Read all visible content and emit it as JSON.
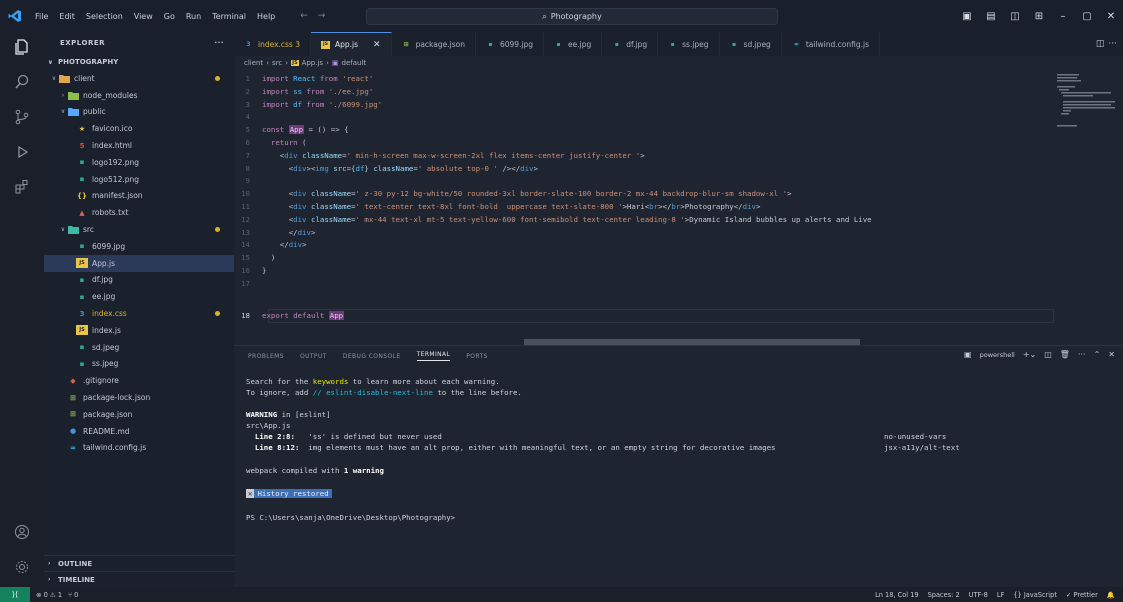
{
  "titlebar": {
    "menu": [
      "File",
      "Edit",
      "Selection",
      "View",
      "Go",
      "Run",
      "Terminal",
      "Help"
    ],
    "search": "Photography"
  },
  "sidebar": {
    "header": "EXPLORER",
    "root": "PHOTOGRAPHY",
    "tree": [
      {
        "label": "client",
        "depth": 0,
        "kind": "folder",
        "open": true,
        "dot": "#d7b32b",
        "color": "#e0a84a"
      },
      {
        "label": "node_modules",
        "depth": 1,
        "kind": "folder",
        "open": false,
        "color": "#8fbf4a"
      },
      {
        "label": "public",
        "depth": 1,
        "kind": "folder",
        "open": true,
        "color": "#58a6ff"
      },
      {
        "label": "favicon.ico",
        "depth": 2,
        "kind": "file",
        "glyph": "★",
        "color": "#e8c547"
      },
      {
        "label": "index.html",
        "depth": 2,
        "kind": "file",
        "glyph": "5",
        "color": "#e44d26"
      },
      {
        "label": "logo192.png",
        "depth": 2,
        "kind": "file",
        "glyph": "▪",
        "color": "#2bb08d"
      },
      {
        "label": "logo512.png",
        "depth": 2,
        "kind": "file",
        "glyph": "▪",
        "color": "#2bb08d"
      },
      {
        "label": "manifest.json",
        "depth": 2,
        "kind": "file",
        "glyph": "{}",
        "color": "#e8c547"
      },
      {
        "label": "robots.txt",
        "depth": 2,
        "kind": "file",
        "glyph": "▲",
        "color": "#e05d5d"
      },
      {
        "label": "src",
        "depth": 1,
        "kind": "folder",
        "open": true,
        "dot": "#d7b32b",
        "color": "#3fb8a5"
      },
      {
        "label": "6099.jpg",
        "depth": 2,
        "kind": "file",
        "glyph": "▪",
        "color": "#2bb08d"
      },
      {
        "label": "App.js",
        "depth": 2,
        "kind": "file",
        "glyph": "JS",
        "color": "#e8c547",
        "selected": true
      },
      {
        "label": "df.jpg",
        "depth": 2,
        "kind": "file",
        "glyph": "▪",
        "color": "#2bb08d"
      },
      {
        "label": "ee.jpg",
        "depth": 2,
        "kind": "file",
        "glyph": "▪",
        "color": "#2bb08d"
      },
      {
        "label": "index.css",
        "depth": 2,
        "kind": "file",
        "glyph": "3",
        "color": "#3c8ed8",
        "dot": "#d7b32b",
        "warn": true
      },
      {
        "label": "index.js",
        "depth": 2,
        "kind": "file",
        "glyph": "JS",
        "color": "#e8c547"
      },
      {
        "label": "sd.jpeg",
        "depth": 2,
        "kind": "file",
        "glyph": "▪",
        "color": "#2bb08d"
      },
      {
        "label": "ss.jpeg",
        "depth": 2,
        "kind": "file",
        "glyph": "▪",
        "color": "#2bb08d"
      },
      {
        "label": ".gitignore",
        "depth": 1,
        "kind": "file",
        "glyph": "◆",
        "color": "#e05d44"
      },
      {
        "label": "package-lock.json",
        "depth": 1,
        "kind": "file",
        "glyph": "⊞",
        "color": "#8cc152"
      },
      {
        "label": "package.json",
        "depth": 1,
        "kind": "file",
        "glyph": "⊞",
        "color": "#8cc152"
      },
      {
        "label": "README.md",
        "depth": 1,
        "kind": "file",
        "glyph": "●",
        "color": "#4a90e2"
      },
      {
        "label": "tailwind.config.js",
        "depth": 1,
        "kind": "file",
        "glyph": "≈",
        "color": "#38bdf8"
      }
    ],
    "outline": "OUTLINE",
    "timeline": "TIMELINE"
  },
  "tabs": [
    {
      "label": "index.css 3",
      "glyph": "3",
      "color": "#3c8ed8",
      "warn": true
    },
    {
      "label": "App.js",
      "glyph": "JS",
      "color": "#e8c547",
      "active": true
    },
    {
      "label": "package.json",
      "glyph": "⊞",
      "color": "#8cc152"
    },
    {
      "label": "6099.jpg",
      "glyph": "▪",
      "color": "#2bb08d"
    },
    {
      "label": "ee.jpg",
      "glyph": "▪",
      "color": "#2bb08d"
    },
    {
      "label": "df.jpg",
      "glyph": "▪",
      "color": "#2bb08d"
    },
    {
      "label": "ss.jpeg",
      "glyph": "▪",
      "color": "#2bb08d"
    },
    {
      "label": "sd.jpeg",
      "glyph": "▪",
      "color": "#2bb08d"
    },
    {
      "label": "tailwind.config.js",
      "glyph": "≈",
      "color": "#38bdf8"
    }
  ],
  "breadcrumb": [
    "client",
    "src",
    "App.js",
    "default"
  ],
  "editor": {
    "current_line": "18",
    "lines": [
      {
        "n": "1",
        "code": "import React from 'react'"
      },
      {
        "n": "2",
        "code": "import ss from './ee.jpg'"
      },
      {
        "n": "3",
        "code": "import df from './6099.jpg'"
      },
      {
        "n": "4",
        "code": ""
      },
      {
        "n": "5",
        "code": "const App = () => {"
      },
      {
        "n": "6",
        "code": "  return ("
      },
      {
        "n": "7",
        "code": "    <div className=' min-h-screen max-w-screen-2xl flex items-center justify-center '>"
      },
      {
        "n": "8",
        "code": "      <div><img src={df} className=' absolute top-0 ' /></div>"
      },
      {
        "n": "9",
        "code": ""
      },
      {
        "n": "10",
        "code": "      <div className=' z-30 py-12 bg-white/50 rounded-3xl border-slate-100 border-2 mx-44 backdrop-blur-sm shadow-xl '>"
      },
      {
        "n": "11",
        "code": "      <div className=' text-center text-8xl font-bold  uppercase text-slate-800 '>Hari<br></br>Photography</div>"
      },
      {
        "n": "12",
        "code": "      <div className=' mx-44 text-xl mt-5 text-yellow-600 font-semibold text-center leading-8 '>Dynamic Island bubbles up alerts and Live"
      },
      {
        "n": "13",
        "code": "      </div>"
      },
      {
        "n": "14",
        "code": "    </div>"
      },
      {
        "n": "15",
        "code": "  )"
      },
      {
        "n": "16",
        "code": "}"
      },
      {
        "n": "17",
        "code": ""
      },
      {
        "n": "18",
        "code": "export default App"
      }
    ]
  },
  "panel": {
    "tabs": [
      "PROBLEMS",
      "OUTPUT",
      "DEBUG CONSOLE",
      "TERMINAL",
      "PORTS"
    ],
    "active_tab": "TERMINAL",
    "shell": "powershell",
    "terminal": {
      "l1_pre": "Search for the ",
      "l1_kw": "keywords",
      "l1_post": " to learn more about each warning.",
      "l2_pre": "To ignore, add ",
      "l2_kw": "// eslint-disable-next-line",
      "l2_post": " to the line before.",
      "l3_warn": "WARNING",
      "l3_post": " in [eslint]",
      "l4": "src\\App.js",
      "l5_loc": "  Line 2:8:",
      "l5_msg": "   'ss' is defined but never used",
      "l5_rule": "no-unused-vars",
      "l6_loc": "  Line 8:12:",
      "l6_msg": "  img elements must have an alt prop, either with meaningful text, or an empty string for decorative images",
      "l6_rule": "jsx-a11y/alt-text",
      "l7_pre": "webpack compiled with ",
      "l7_warn": "1 warning",
      "l8": "History restored",
      "l9": "PS C:\\Users\\sanja\\OneDrive\\Desktop\\Photography>"
    }
  },
  "status": {
    "problems": "⊗ 0 ⚠ 1",
    "ports": "⑂ 0",
    "position": "Ln 18, Col 19",
    "spaces": "Spaces: 2",
    "encoding": "UTF-8",
    "eol": "LF",
    "language": "{} JavaScript",
    "formatter": "✓ Prettier"
  },
  "colors": {
    "accent": "#4f8fe6",
    "statusbar_remote": "#16825d"
  }
}
